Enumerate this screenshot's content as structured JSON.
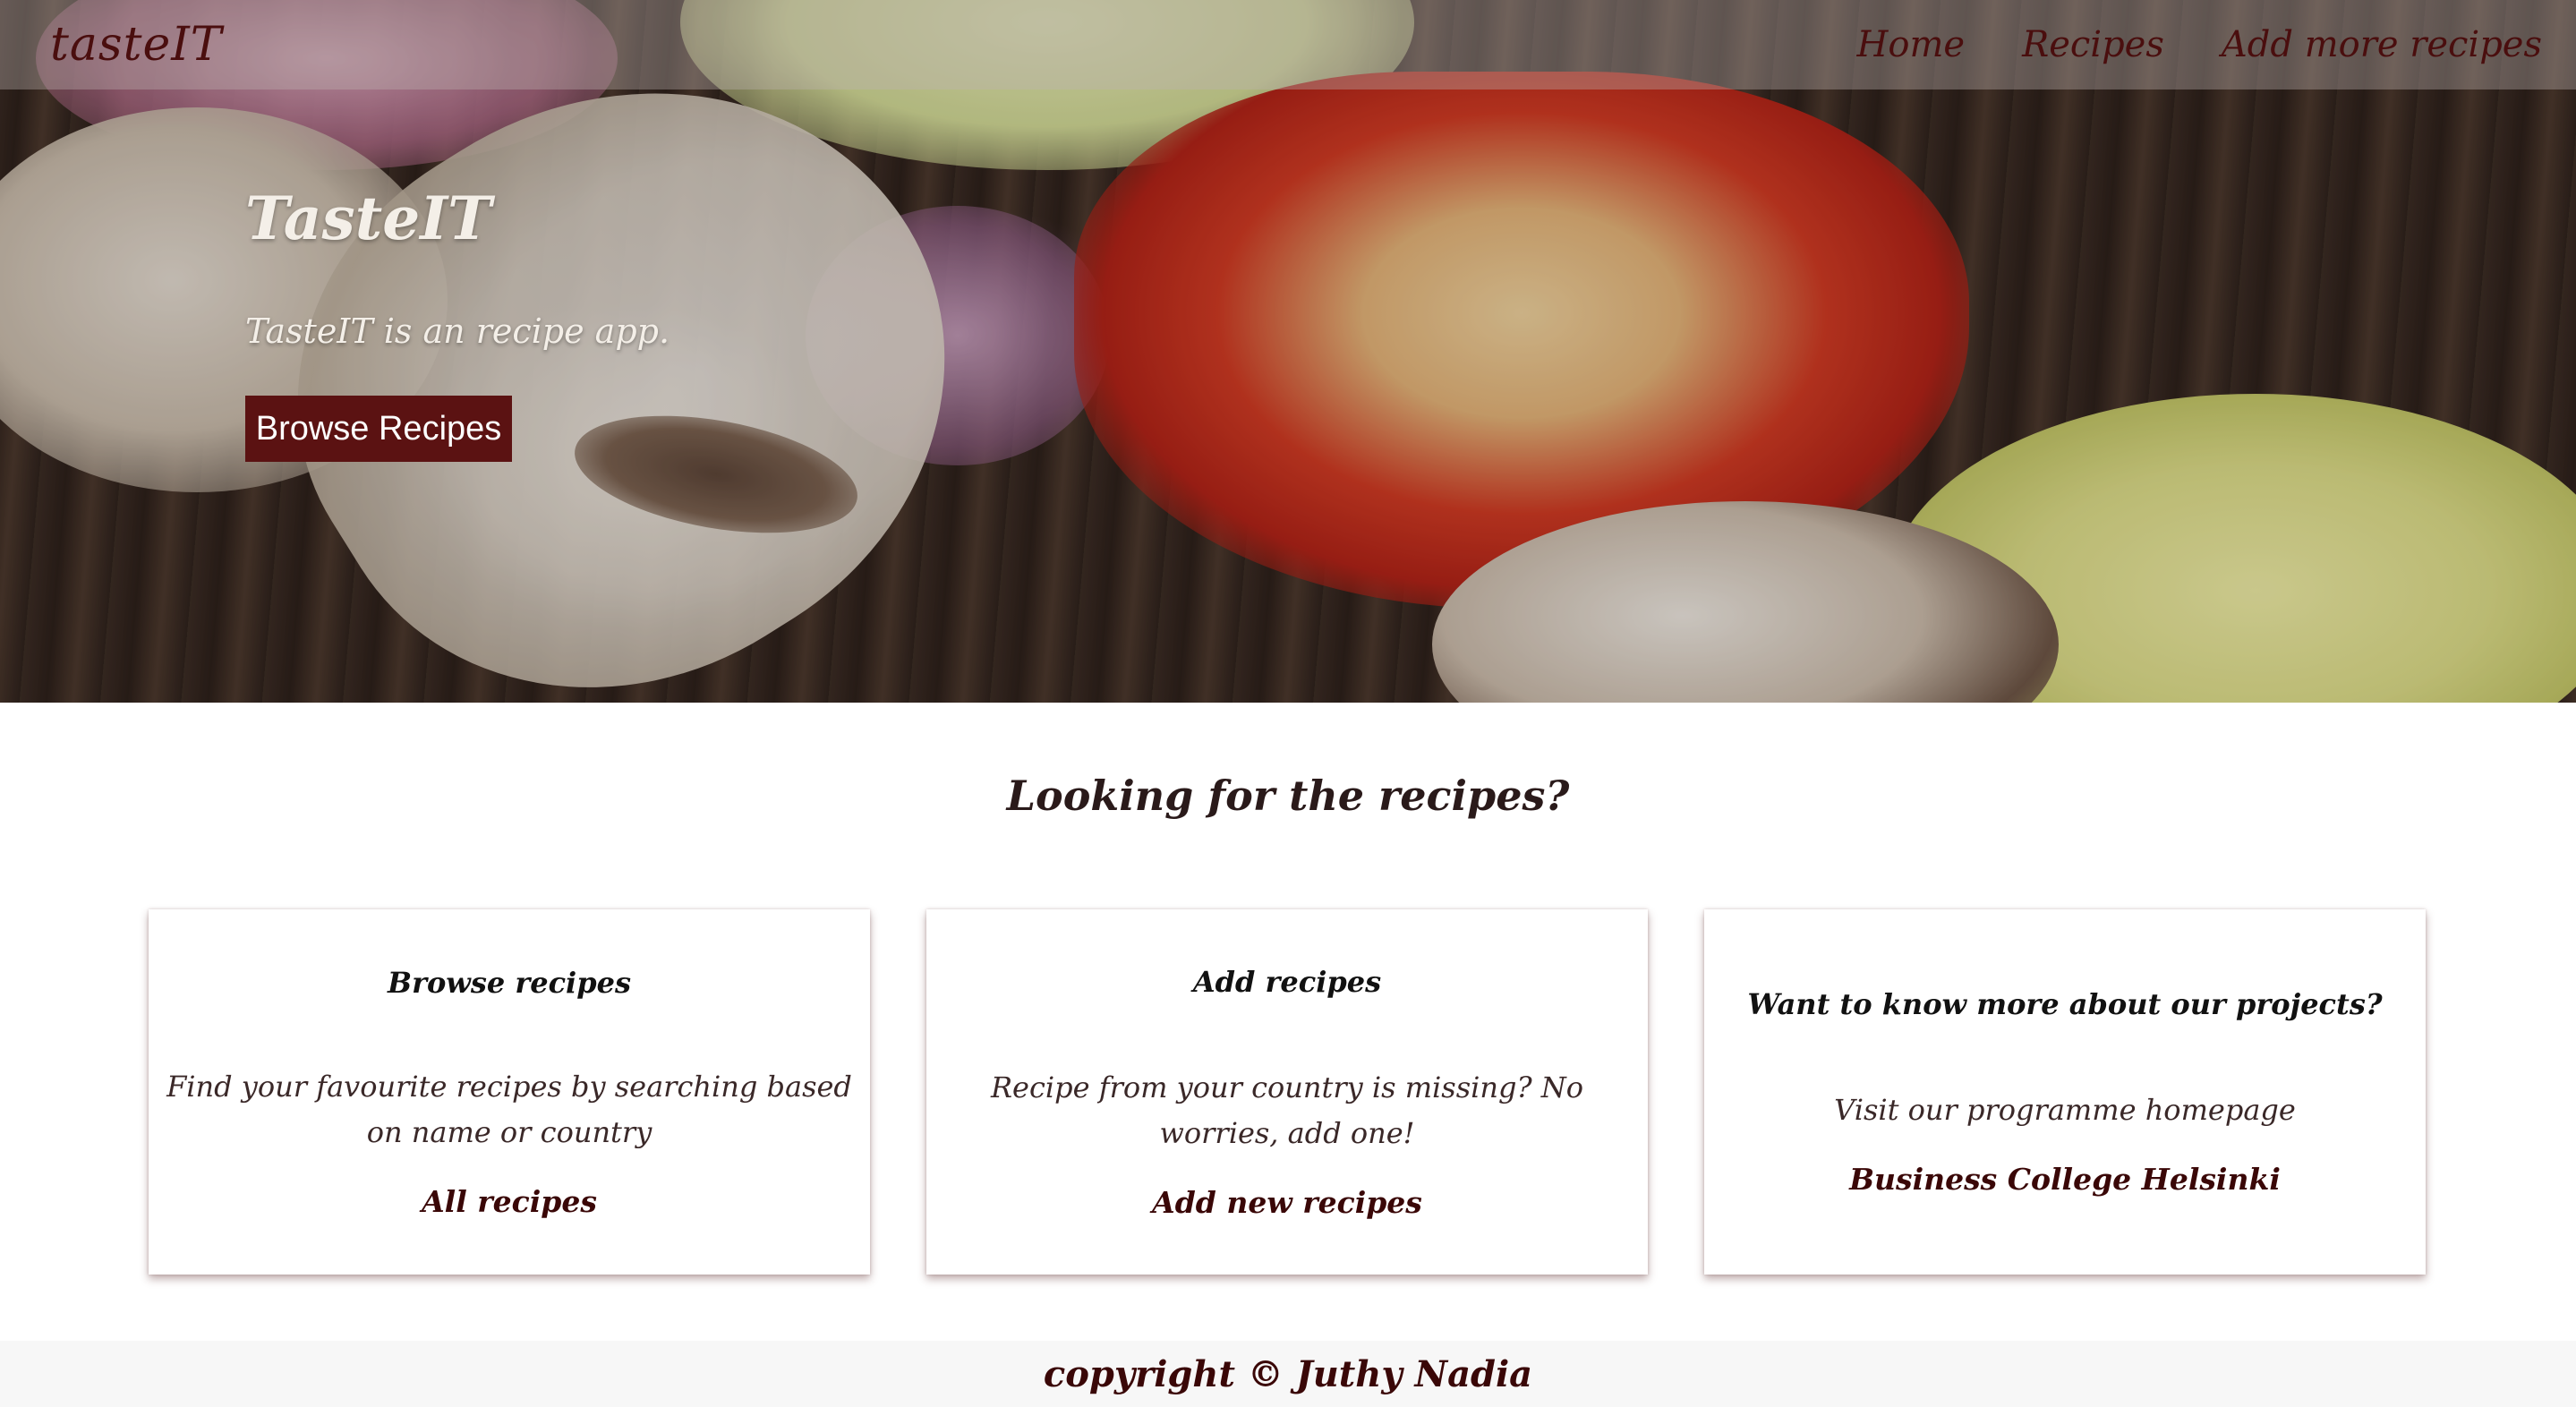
{
  "navbar": {
    "brand": "tasteIT",
    "links": [
      "Home",
      "Recipes",
      "Add more recipes"
    ]
  },
  "hero": {
    "title": "TasteIT",
    "subtitle": "TasteIT is an recipe app.",
    "button_label": "Browse Recipes"
  },
  "main": {
    "heading": "Looking for the recipes?",
    "cards": [
      {
        "title": "Browse recipes",
        "text": "Find your favourite recipes by searching based on name or country",
        "link": "All recipes"
      },
      {
        "title": "Add recipes",
        "text": "Recipe from your country is missing? No worries, add one!",
        "link": "Add new recipes"
      },
      {
        "title": "Want to know more about our projects?",
        "text": "Visit our programme homepage",
        "link": "Business College Helsinki"
      }
    ]
  },
  "footer": {
    "text": "copyright © Juthy Nadia"
  },
  "colors": {
    "brand_dark": "#4a0e0e",
    "button_bg": "#5b1212",
    "footer_bg": "#f7f7f7"
  }
}
